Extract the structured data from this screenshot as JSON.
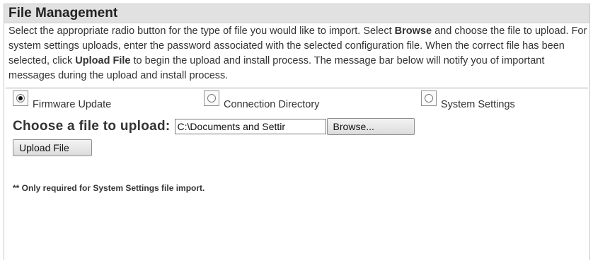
{
  "section": {
    "title": "File Management",
    "description": {
      "part1": "Select the appropriate radio button for the type of file you would like to import. Select ",
      "browse_word": "Browse",
      "part2": " and choose the file to upload. For system settings uploads, enter the password associated with the selected configuration file. When the correct file has been selected, click ",
      "upload_word": "Upload File",
      "part3": " to begin the upload and install process. The message bar below will notify you of important messages during the upload and install process."
    }
  },
  "file_types": [
    {
      "label": "Firmware Update",
      "selected": true
    },
    {
      "label": "Connection Directory",
      "selected": false
    },
    {
      "label": "System Settings",
      "selected": false
    }
  ],
  "upload": {
    "label": "Choose a file to upload:",
    "file_value": "C:\\Documents and Settir",
    "browse_label": "Browse...",
    "upload_label": "Upload File"
  },
  "footnote": "** Only required for System Settings file import."
}
